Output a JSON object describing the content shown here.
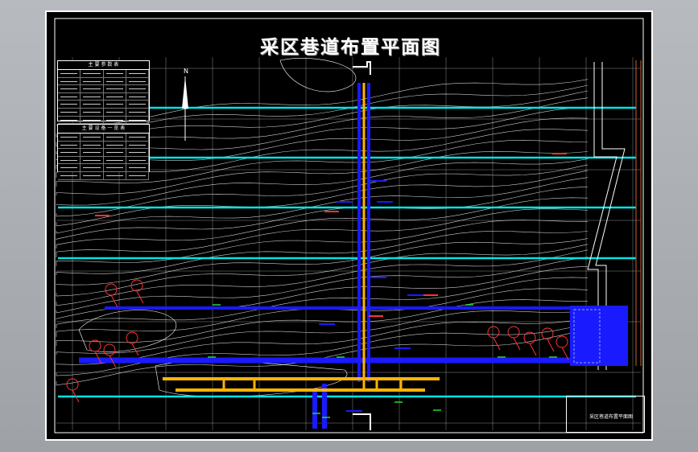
{
  "drawing": {
    "title": "采区巷道布置平面图",
    "north_label": "N",
    "title_block_name": "采区巷道布置平面图",
    "table1": {
      "header": "主 要 参 数 表",
      "rows": 8,
      "cols": 4
    },
    "table2": {
      "header": "主 要 设 备 一 览 表",
      "rows": 6,
      "cols": 4
    }
  },
  "colors": {
    "background": "#000000",
    "contours": "#ffffff",
    "grid": "#ffffff",
    "coal_seam_lines": "#00e5e5",
    "roadways": "#1a1aff",
    "haulage": "#ffb400",
    "geology_marks": "#ff3333",
    "labels_green": "#22dd22"
  }
}
